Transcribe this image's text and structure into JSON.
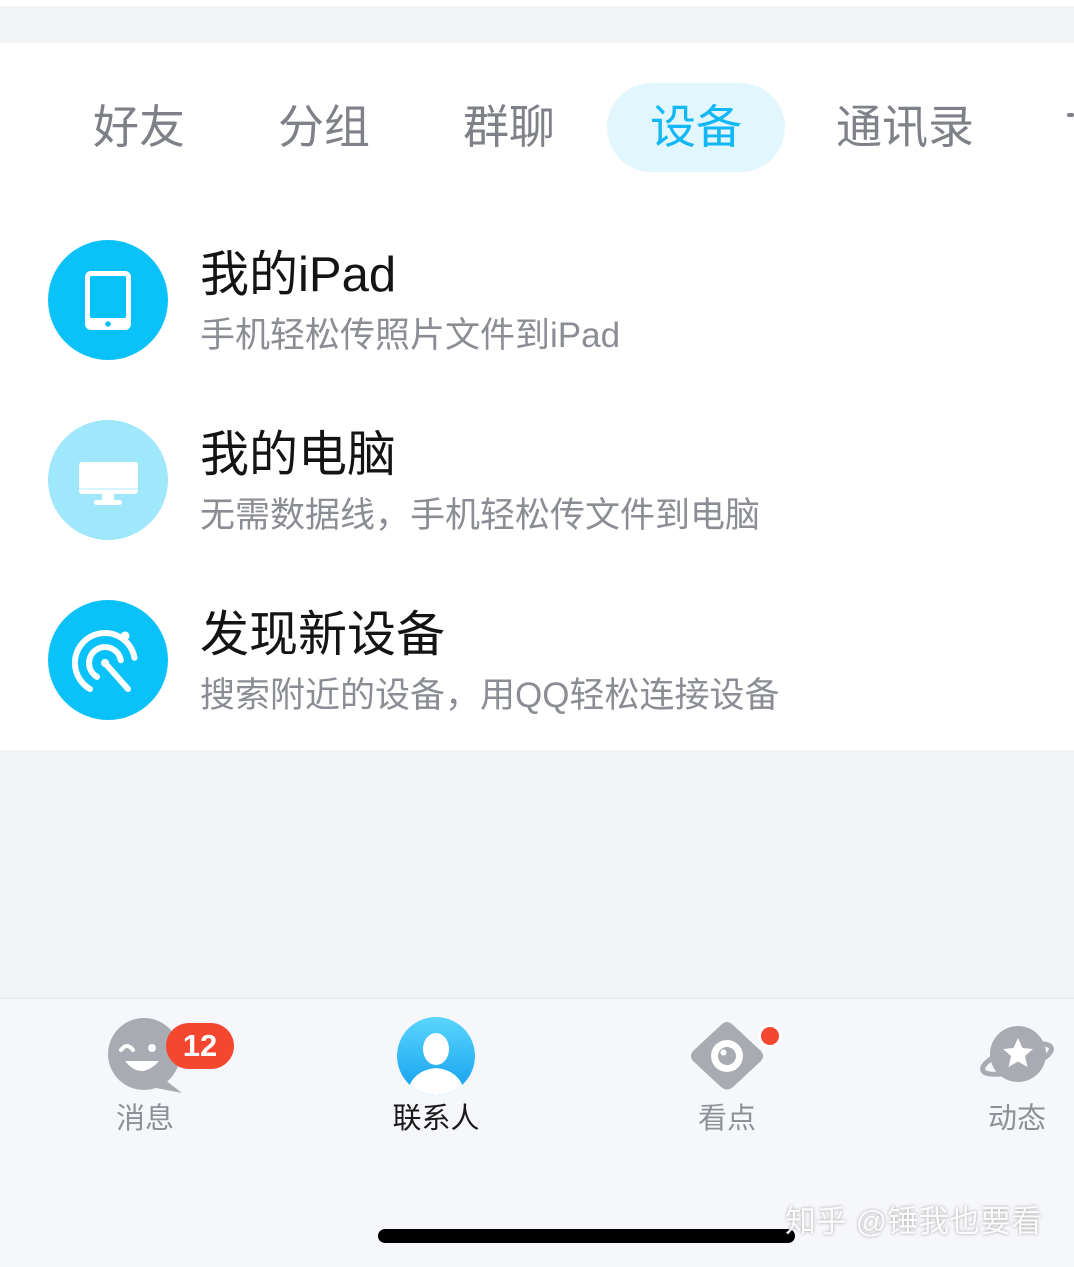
{
  "tabs": [
    {
      "label": "好友",
      "selected": false
    },
    {
      "label": "分组",
      "selected": false
    },
    {
      "label": "群聊",
      "selected": false
    },
    {
      "label": "设备",
      "selected": true
    },
    {
      "label": "通讯录",
      "selected": false
    }
  ],
  "devices": [
    {
      "title": "我的iPad",
      "subtitle": "手机轻松传照片文件到iPad",
      "icon": "tablet-icon"
    },
    {
      "title": "我的电脑",
      "subtitle": "无需数据线，手机轻松传文件到电脑",
      "icon": "monitor-icon"
    },
    {
      "title": "发现新设备",
      "subtitle": "搜索附近的设备，用QQ轻松连接设备",
      "icon": "radar-icon"
    }
  ],
  "tab_bar": {
    "items": [
      {
        "label": "消息",
        "icon": "message-face-icon",
        "badge": "12",
        "active": false
      },
      {
        "label": "联系人",
        "icon": "contacts-person-icon",
        "active": true
      },
      {
        "label": "看点",
        "icon": "eye-icon",
        "has_dot": true,
        "active": false
      },
      {
        "label": "动态",
        "icon": "planet-star-icon",
        "active": false
      }
    ]
  },
  "watermark": "知乎 @锤我也要看",
  "colors": {
    "accent": "#12b7f5",
    "accent_pill_bg": "#e2f6fd",
    "icon_primary": "#0ac2fa",
    "icon_light": "#9fe7fb",
    "badge_red": "#f5472f",
    "tab_inactive_text": "#7e8188",
    "page_bg": "#f2f3f7",
    "tab_bar_bg": "#f6f7fa"
  }
}
